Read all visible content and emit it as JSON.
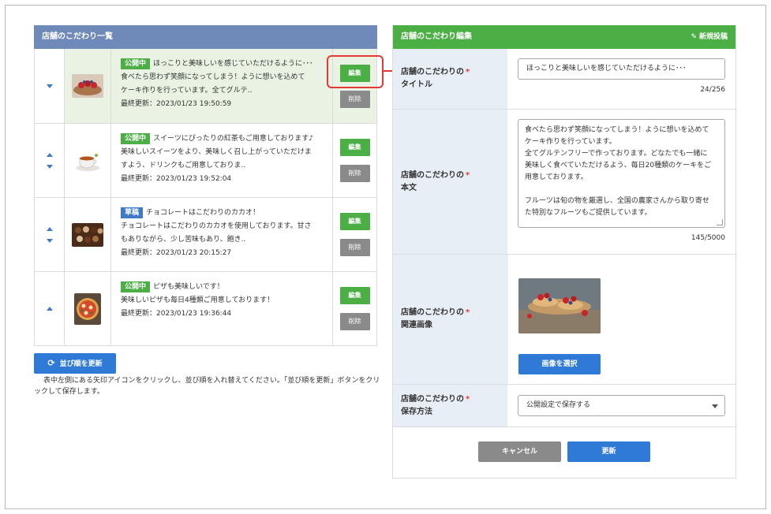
{
  "list_panel": {
    "header": "店舗のこだわり一覧",
    "edit_label": "編集",
    "delete_label": "削除",
    "items": [
      {
        "status": "公開中",
        "title": "ほっこりと美味しいを感じていただけるように･･･",
        "body_line1": "食べたら思わず笑顔になってしまう！ように想いを込めて",
        "body_line2": "ケーキ作りを行っています。全てグルテ..",
        "updated": "最終更新：2023/01/23 19:50:59"
      },
      {
        "status": "公開中",
        "title": "スイーツにぴったりの紅茶もご用意しております♪",
        "body_line1": "美味しいスイーツをより、美味しく召し上がっていただけま",
        "body_line2": "すよう、ドリンクもご用意しておりま..",
        "updated": "最終更新：2023/01/23 19:52:04"
      },
      {
        "status": "草稿",
        "title": "チョコレートはこだわりのカカオ！",
        "body_line1": "チョコレートはこだわりのカカオを使用しております。甘さ",
        "body_line2": "もありながら、少し苦味もあり、飽き..",
        "updated": "最終更新：2023/01/23 20:15:27"
      },
      {
        "status": "公開中",
        "title": "ピザも美味しいです！",
        "body_line1": "美味しいピザも毎日4種類ご用意しております！",
        "body_line2": "",
        "updated": "最終更新：2023/01/23 19:36:44"
      }
    ],
    "reorder_button": "並び順を更新",
    "note": "表中左側にある矢印アイコンをクリックし、並び順を入れ替えてください。「並び順を更新」ボタンをクリックして保存します。"
  },
  "edit_panel": {
    "header": "店舗のこだわり編集",
    "new_post": "新規投稿",
    "title_label_1": "店舗のこだわりの",
    "title_label_2": "タイトル",
    "title_value": "ほっこりと美味しいを感じていただけるように･･･",
    "title_counter": "24/256",
    "body_label_1": "店舗のこだわりの",
    "body_label_2": "本文",
    "body_value": "食べたら思わず笑顔になってしまう！ように想いを込めて\nケーキ作りを行っています。\n全てグルテンフリーで作っております。どなたでも一緒に\n美味しく食べていただけるよう、毎日20種類のケーキをご\n用意しております。\n\nフルーツは旬の物を厳選し、全国の農家さんから取り寄せ\nた特別なフルーツもご提供しています。",
    "body_counter": "145/5000",
    "image_label_1": "店舗のこだわりの",
    "image_label_2": "関連画像",
    "pick_image": "画像を選択",
    "save_label_1": "店舗のこだわりの",
    "save_label_2": "保存方法",
    "save_value": "公開設定で保存する",
    "required_mark": "*",
    "cancel": "キャンセル",
    "update": "更新"
  },
  "colors": {
    "list_header": "#6f89b8",
    "edit_header": "#4caf45",
    "primary": "#2f7ad6",
    "highlight": "#e53935"
  }
}
